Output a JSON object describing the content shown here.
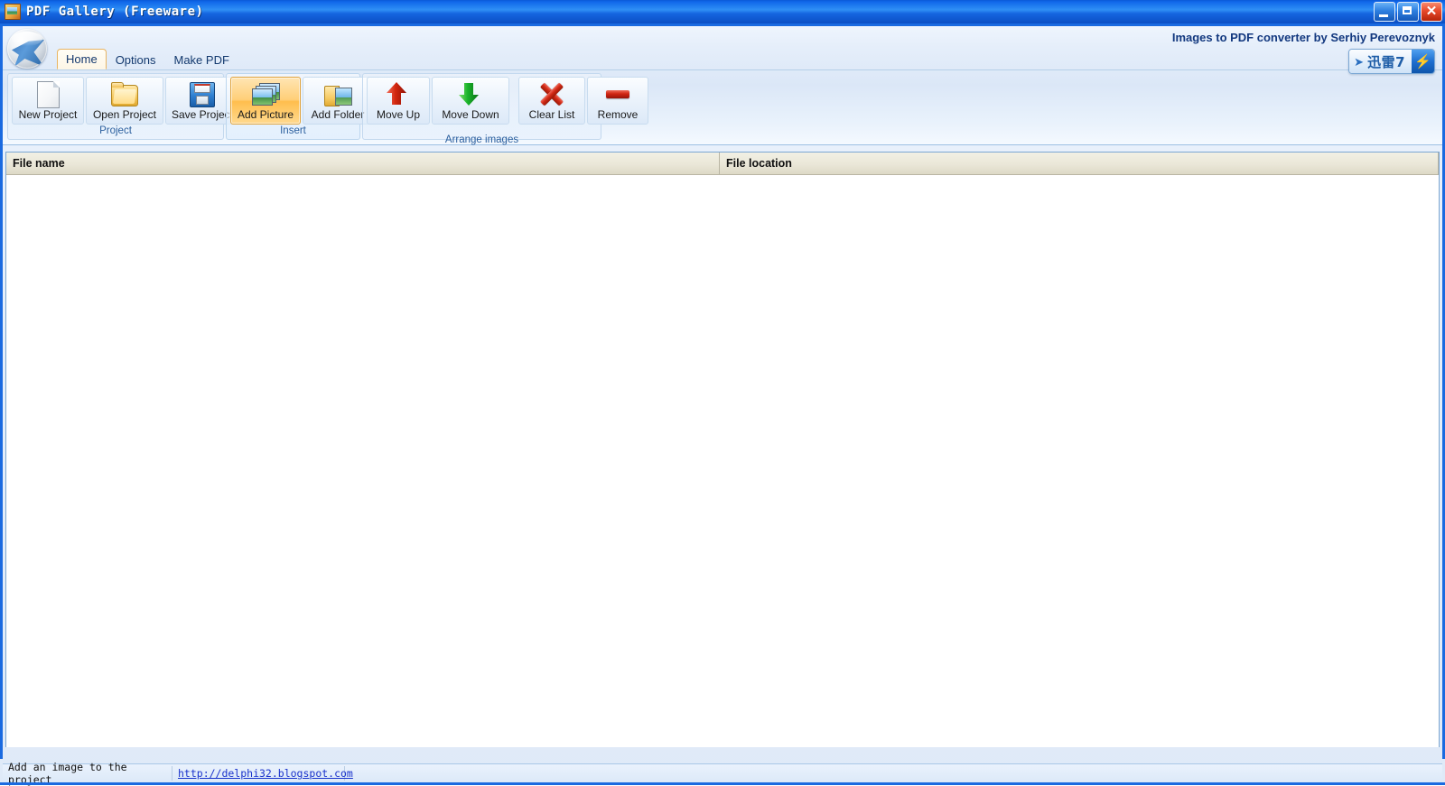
{
  "window": {
    "title": "PDF Gallery (Freeware)",
    "icon": "app-image-icon",
    "controls": [
      {
        "name": "minimize-button",
        "glyph": "_"
      },
      {
        "name": "restore-button",
        "glyph": "❐"
      },
      {
        "name": "close-button",
        "glyph": "✕"
      }
    ]
  },
  "ribbon": {
    "app_button": "app-orb-button",
    "brand_text": "Images to PDF converter by Serhiy Perevoznyk",
    "tabs": [
      {
        "label": "Home",
        "active": true
      },
      {
        "label": "Options",
        "active": false
      },
      {
        "label": "Make PDF",
        "active": false
      }
    ],
    "groups": [
      {
        "caption": "Project",
        "highlight": false,
        "buttons": [
          {
            "label": "New Project",
            "icon": "new-page-icon",
            "state": "normal"
          },
          {
            "label": "Open Project",
            "icon": "open-folder-icon",
            "state": "normal"
          },
          {
            "label": "Save Project",
            "icon": "floppy-disk-icon",
            "state": "normal"
          }
        ]
      },
      {
        "caption": "Insert",
        "highlight": true,
        "buttons": [
          {
            "label": "Add Picture",
            "icon": "picture-stack-icon",
            "state": "hover"
          },
          {
            "label": "Add Folder",
            "icon": "folder-picture-icon",
            "state": "normal"
          }
        ]
      },
      {
        "caption": "Arrange images",
        "highlight": false,
        "buttons": [
          {
            "label": "Move Up",
            "icon": "arrow-up-red-icon",
            "state": "normal"
          },
          {
            "label": "Move Down",
            "icon": "arrow-down-green-icon",
            "state": "normal"
          },
          {
            "label": "Clear List",
            "icon": "red-x-icon",
            "state": "normal"
          },
          {
            "label": "Remove",
            "icon": "red-minus-icon",
            "state": "normal"
          }
        ]
      }
    ]
  },
  "overlay_widget": {
    "name": "xunlei-thunder-widget",
    "bird_icon": "➤",
    "label": "迅雷7",
    "bolt_icon": "⚡"
  },
  "list": {
    "columns": [
      {
        "label": "File name"
      },
      {
        "label": "File location"
      }
    ],
    "rows": []
  },
  "status": {
    "hint": "Add an image to the project",
    "link": "http://delphi32.blogspot.com"
  },
  "colors": {
    "titlebar_blue": "#1168ea",
    "ribbon_blue": "#dbe7f7",
    "hover_orange": "#ffbe4d",
    "brand_navy": "#12387f",
    "link_blue": "#1a33cc",
    "header_beige": "#eae7d8"
  }
}
